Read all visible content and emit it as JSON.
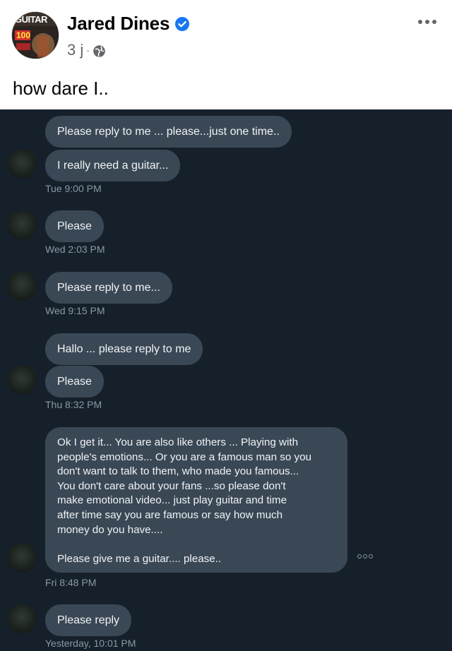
{
  "post": {
    "author": "Jared Dines",
    "time": "3 j",
    "dot": "·",
    "caption": "how dare I..",
    "avatar_text": "GUITAR",
    "avatar_number": "100"
  },
  "chat": {
    "messages": [
      {
        "text": "Please reply to me ... please...just one time.."
      },
      {
        "text": "I really need a guitar..."
      },
      {
        "text": "Please"
      },
      {
        "text": "Please reply to me..."
      },
      {
        "text": "Hallo ... please reply to me"
      },
      {
        "text": "Please"
      },
      {
        "text": "Ok I get it... You are also like others ... Playing with\npeople's emotions... Or you are a famous man so you\ndon't want to talk to them, who made you famous...\nYou don't care about your fans ...so please don't\nmake emotional video... just play guitar and time\nafter time say you are famous or say how much\nmoney do you have....\n\nPlease give me a guitar.... please.."
      },
      {
        "text": "Please reply"
      }
    ],
    "timestamps": [
      "Tue 9:00 PM",
      "Wed 2:03 PM",
      "Wed 9:15 PM",
      "Thu 8:32 PM",
      "Fri 8:48 PM",
      "Yesterday, 10:01 PM"
    ]
  },
  "colors": {
    "chat_background": "#15202b",
    "bubble": "#3a4856",
    "verified": "#1877f2"
  }
}
